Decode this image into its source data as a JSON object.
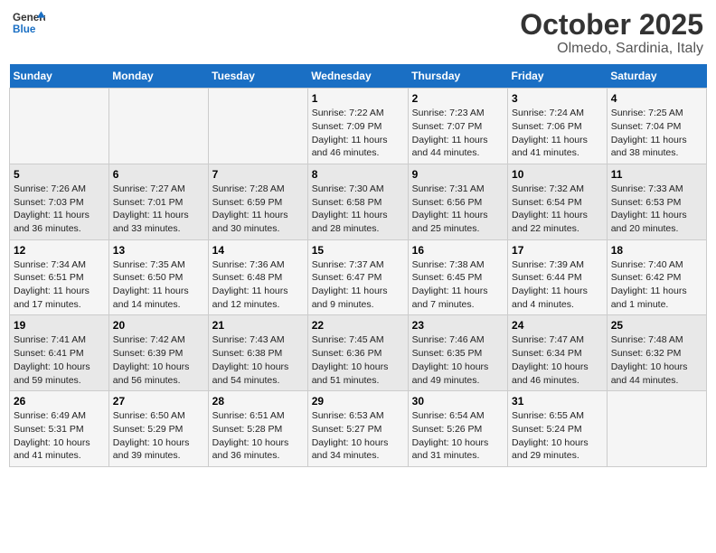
{
  "header": {
    "logo_general": "General",
    "logo_blue": "Blue",
    "month_title": "October 2025",
    "location": "Olmedo, Sardinia, Italy"
  },
  "weekdays": [
    "Sunday",
    "Monday",
    "Tuesday",
    "Wednesday",
    "Thursday",
    "Friday",
    "Saturday"
  ],
  "weeks": [
    [
      {
        "day": "",
        "info": ""
      },
      {
        "day": "",
        "info": ""
      },
      {
        "day": "",
        "info": ""
      },
      {
        "day": "1",
        "info": "Sunrise: 7:22 AM\nSunset: 7:09 PM\nDaylight: 11 hours and 46 minutes."
      },
      {
        "day": "2",
        "info": "Sunrise: 7:23 AM\nSunset: 7:07 PM\nDaylight: 11 hours and 44 minutes."
      },
      {
        "day": "3",
        "info": "Sunrise: 7:24 AM\nSunset: 7:06 PM\nDaylight: 11 hours and 41 minutes."
      },
      {
        "day": "4",
        "info": "Sunrise: 7:25 AM\nSunset: 7:04 PM\nDaylight: 11 hours and 38 minutes."
      }
    ],
    [
      {
        "day": "5",
        "info": "Sunrise: 7:26 AM\nSunset: 7:03 PM\nDaylight: 11 hours and 36 minutes."
      },
      {
        "day": "6",
        "info": "Sunrise: 7:27 AM\nSunset: 7:01 PM\nDaylight: 11 hours and 33 minutes."
      },
      {
        "day": "7",
        "info": "Sunrise: 7:28 AM\nSunset: 6:59 PM\nDaylight: 11 hours and 30 minutes."
      },
      {
        "day": "8",
        "info": "Sunrise: 7:30 AM\nSunset: 6:58 PM\nDaylight: 11 hours and 28 minutes."
      },
      {
        "day": "9",
        "info": "Sunrise: 7:31 AM\nSunset: 6:56 PM\nDaylight: 11 hours and 25 minutes."
      },
      {
        "day": "10",
        "info": "Sunrise: 7:32 AM\nSunset: 6:54 PM\nDaylight: 11 hours and 22 minutes."
      },
      {
        "day": "11",
        "info": "Sunrise: 7:33 AM\nSunset: 6:53 PM\nDaylight: 11 hours and 20 minutes."
      }
    ],
    [
      {
        "day": "12",
        "info": "Sunrise: 7:34 AM\nSunset: 6:51 PM\nDaylight: 11 hours and 17 minutes."
      },
      {
        "day": "13",
        "info": "Sunrise: 7:35 AM\nSunset: 6:50 PM\nDaylight: 11 hours and 14 minutes."
      },
      {
        "day": "14",
        "info": "Sunrise: 7:36 AM\nSunset: 6:48 PM\nDaylight: 11 hours and 12 minutes."
      },
      {
        "day": "15",
        "info": "Sunrise: 7:37 AM\nSunset: 6:47 PM\nDaylight: 11 hours and 9 minutes."
      },
      {
        "day": "16",
        "info": "Sunrise: 7:38 AM\nSunset: 6:45 PM\nDaylight: 11 hours and 7 minutes."
      },
      {
        "day": "17",
        "info": "Sunrise: 7:39 AM\nSunset: 6:44 PM\nDaylight: 11 hours and 4 minutes."
      },
      {
        "day": "18",
        "info": "Sunrise: 7:40 AM\nSunset: 6:42 PM\nDaylight: 11 hours and 1 minute."
      }
    ],
    [
      {
        "day": "19",
        "info": "Sunrise: 7:41 AM\nSunset: 6:41 PM\nDaylight: 10 hours and 59 minutes."
      },
      {
        "day": "20",
        "info": "Sunrise: 7:42 AM\nSunset: 6:39 PM\nDaylight: 10 hours and 56 minutes."
      },
      {
        "day": "21",
        "info": "Sunrise: 7:43 AM\nSunset: 6:38 PM\nDaylight: 10 hours and 54 minutes."
      },
      {
        "day": "22",
        "info": "Sunrise: 7:45 AM\nSunset: 6:36 PM\nDaylight: 10 hours and 51 minutes."
      },
      {
        "day": "23",
        "info": "Sunrise: 7:46 AM\nSunset: 6:35 PM\nDaylight: 10 hours and 49 minutes."
      },
      {
        "day": "24",
        "info": "Sunrise: 7:47 AM\nSunset: 6:34 PM\nDaylight: 10 hours and 46 minutes."
      },
      {
        "day": "25",
        "info": "Sunrise: 7:48 AM\nSunset: 6:32 PM\nDaylight: 10 hours and 44 minutes."
      }
    ],
    [
      {
        "day": "26",
        "info": "Sunrise: 6:49 AM\nSunset: 5:31 PM\nDaylight: 10 hours and 41 minutes."
      },
      {
        "day": "27",
        "info": "Sunrise: 6:50 AM\nSunset: 5:29 PM\nDaylight: 10 hours and 39 minutes."
      },
      {
        "day": "28",
        "info": "Sunrise: 6:51 AM\nSunset: 5:28 PM\nDaylight: 10 hours and 36 minutes."
      },
      {
        "day": "29",
        "info": "Sunrise: 6:53 AM\nSunset: 5:27 PM\nDaylight: 10 hours and 34 minutes."
      },
      {
        "day": "30",
        "info": "Sunrise: 6:54 AM\nSunset: 5:26 PM\nDaylight: 10 hours and 31 minutes."
      },
      {
        "day": "31",
        "info": "Sunrise: 6:55 AM\nSunset: 5:24 PM\nDaylight: 10 hours and 29 minutes."
      },
      {
        "day": "",
        "info": ""
      }
    ]
  ]
}
